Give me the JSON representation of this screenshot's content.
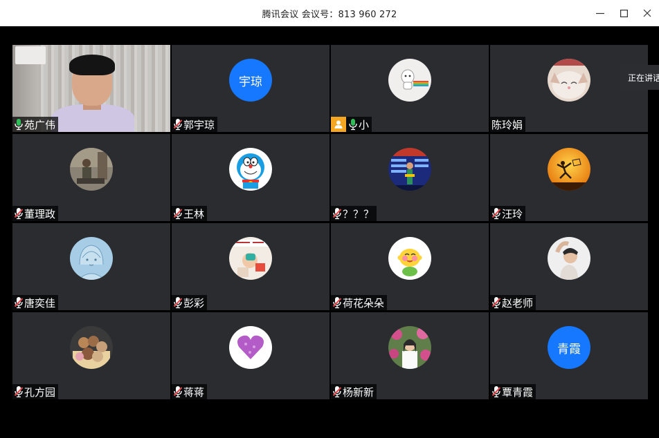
{
  "window": {
    "title": "腾讯会议 会议号：813 960 272",
    "controls": [
      "minimize-icon",
      "maximize-icon",
      "close-icon"
    ]
  },
  "speaking_tip": "正在讲话",
  "colors": {
    "tile_bg": "#2a2c30",
    "active_border": "#2fbe5a",
    "text_avatar": "#1677ff",
    "host_badge": "#f5a623",
    "mic_on": "#2fbe5a",
    "mic_off": "#e5484d"
  },
  "participants": [
    {
      "name": "苑广伟",
      "mic": "on",
      "avatar": "video",
      "active": true
    },
    {
      "name": "郭宇琼",
      "mic": "off",
      "avatar": "text",
      "avatar_text": "宇琼"
    },
    {
      "name": "小",
      "mic": "on",
      "avatar": "image",
      "host": true
    },
    {
      "name": "陈玲娟",
      "mic": "none",
      "avatar": "image"
    },
    {
      "name": "董理政",
      "mic": "off",
      "avatar": "image"
    },
    {
      "name": "王林",
      "mic": "off",
      "avatar": "image"
    },
    {
      "name": "？？？",
      "mic": "off",
      "avatar": "image"
    },
    {
      "name": "汪玲",
      "mic": "off",
      "avatar": "image"
    },
    {
      "name": "唐奕佳",
      "mic": "off",
      "avatar": "image"
    },
    {
      "name": "彭彩",
      "mic": "off",
      "avatar": "image"
    },
    {
      "name": "荷花朵朵",
      "mic": "off",
      "avatar": "image"
    },
    {
      "name": "赵老师",
      "mic": "off",
      "avatar": "image"
    },
    {
      "name": "孔方园",
      "mic": "off",
      "avatar": "image"
    },
    {
      "name": "蒋蒋",
      "mic": "off",
      "avatar": "image"
    },
    {
      "name": "杨新新",
      "mic": "off",
      "avatar": "image"
    },
    {
      "name": "覃青霞",
      "mic": "off",
      "avatar": "text",
      "avatar_text": "青霞"
    }
  ]
}
